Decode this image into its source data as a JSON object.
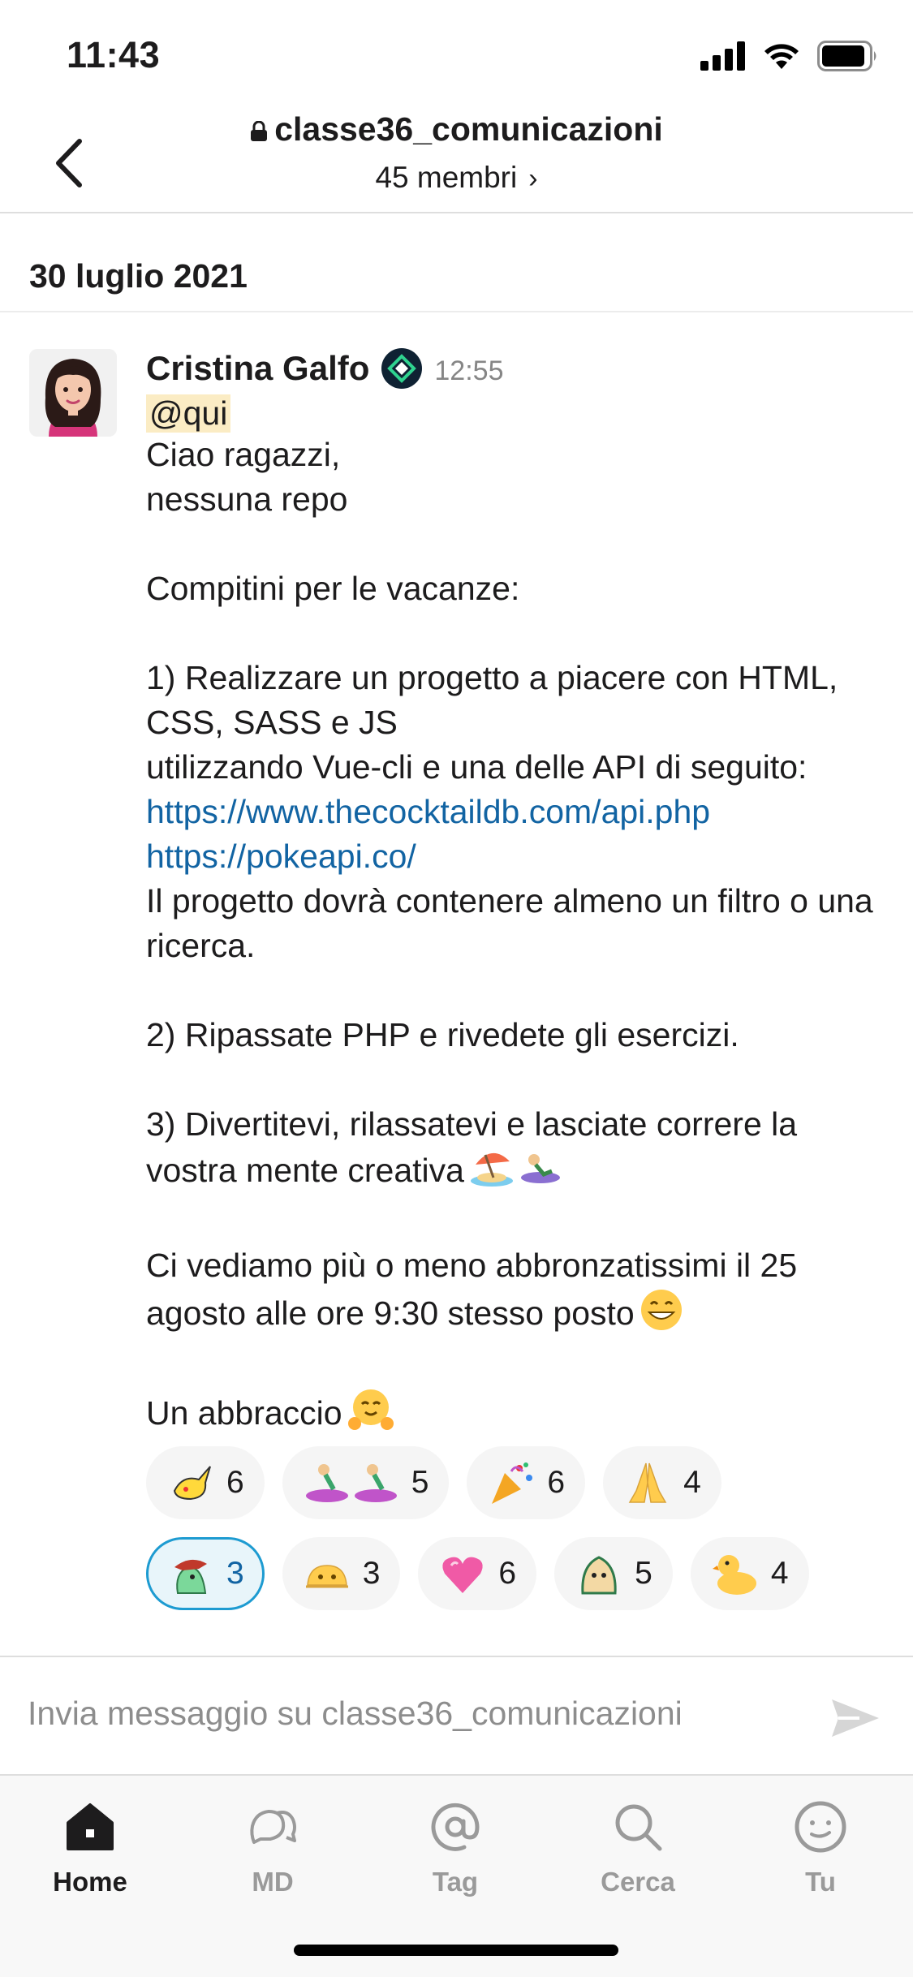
{
  "status_bar": {
    "time": "11:43"
  },
  "header": {
    "channel_name": "classe36_comunicazioni",
    "members": "45 membri"
  },
  "date_divider": "30 luglio 2021",
  "message": {
    "sender": "Cristina Galfo",
    "time": "12:55",
    "mention": "@qui",
    "line_greeting": "Ciao ragazzi,\nnessuna repo\n\nCompitini per le vacanze:\n\n1) Realizzare un progetto a piacere con HTML, CSS, SASS e JS\nutilizzando Vue-cli e una delle API di seguito:",
    "link1": "https://www.thecocktaildb.com/api.php",
    "link2": "https://pokeapi.co/",
    "line_rest": "Il progetto dovrà contenere almeno un filtro o una ricerca.\n\n2) Ripassate PHP e rivedete gli esercizi.\n\n3) Divertitevi, rilassatevi e lasciate correre la vostra mente creativa",
    "line_meet": "Ci vediamo più o meno abbronzatissimi il 25 agosto alle ore 9:30 stesso posto",
    "line_hug": "Un abbraccio"
  },
  "reactions": {
    "row1": [
      {
        "icon": "pikachu-emoji",
        "count": "6"
      },
      {
        "icon": "surfer-emoji",
        "count": "5"
      },
      {
        "icon": "party-popper-emoji",
        "count": "6"
      },
      {
        "icon": "folded-hands-emoji",
        "count": "4"
      }
    ],
    "row2": [
      {
        "icon": "parrot-hat-emoji",
        "count": "3",
        "active": true
      },
      {
        "icon": "melting-face-emoji",
        "count": "3"
      },
      {
        "icon": "heart-emoji",
        "count": "6"
      },
      {
        "icon": "blob-emoji",
        "count": "5"
      },
      {
        "icon": "duck-emoji",
        "count": "4"
      }
    ]
  },
  "composer": {
    "placeholder": "Invia messaggio su classe36_comunicazioni"
  },
  "tabs": [
    {
      "label": "Home",
      "icon": "home-icon",
      "active": true
    },
    {
      "label": "MD",
      "icon": "chat-icon"
    },
    {
      "label": "Tag",
      "icon": "at-icon"
    },
    {
      "label": "Cerca",
      "icon": "search-icon"
    },
    {
      "label": "Tu",
      "icon": "profile-icon"
    }
  ],
  "colors": {
    "link": "#1264a3",
    "mention_bg": "#fbecc4",
    "active_reaction_border": "#1d9bd1"
  }
}
